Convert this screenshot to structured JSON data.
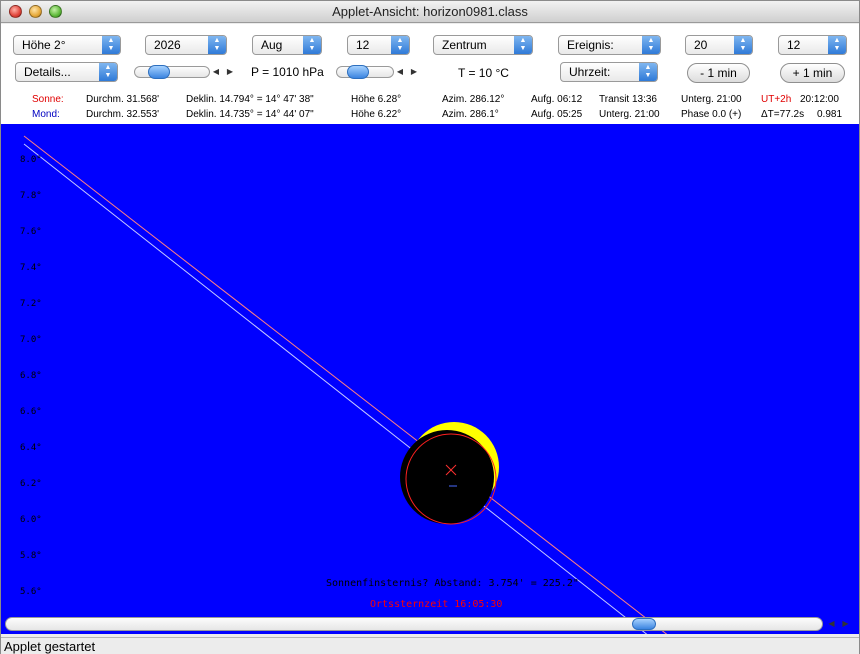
{
  "window": {
    "title": "Applet-Ansicht: horizon0981.class"
  },
  "toolbar": {
    "hoehe_select": "Höhe 2°",
    "year_select": "2026",
    "month_select": "Aug",
    "day_select": "12",
    "view_select": "Zentrum",
    "event_select": "Ereignis:",
    "hour_select": "20",
    "minute_select": "12",
    "details_select": "Details...",
    "pressure_label": "P = 1010 hPa",
    "temperature_label": "T = 10 °C",
    "time_mode_select": "Uhrzeit:",
    "minus_button": "- 1 min",
    "plus_button": "+ 1 min",
    "pressure_slider_value": 0.25,
    "temperature_slider_value": 0.3
  },
  "sun_info": {
    "label": "Sonne:",
    "diameter": "Durchm. 31.568'",
    "declination": "Deklin. 14.794° = 14° 47' 38\"",
    "altitude": "Höhe 6.28°",
    "azimuth": "Azim. 286.12°",
    "rise": "Aufg. 06:12",
    "transit": "Transit 13:36",
    "set": "Unterg. 21:00",
    "timezone": "UT+2h",
    "time": "20:12:00"
  },
  "moon_info": {
    "label": "Mond:",
    "diameter": "Durchm. 32.553'",
    "declination": "Deklin. 14.735° = 14° 44' 07\"",
    "altitude": "Höhe 6.22°",
    "azimuth": "Azim. 286.1°",
    "rise": "Aufg. 05:25",
    "set": "Unterg. 21:00",
    "phase": "Phase 0.0 (+)",
    "delta_t": "ΔT=77.2s",
    "magnitude": "0.981"
  },
  "canvas": {
    "y_labels": [
      "8.0°",
      "7.8°",
      "7.6°",
      "7.4°",
      "7.2°",
      "7.0°",
      "6.8°",
      "6.6°",
      "6.4°",
      "6.2°",
      "6.0°",
      "5.8°",
      "5.6°"
    ],
    "eclipse_message": "Sonnenfinsternis? Abstand: 3.754' = 225.2\"",
    "sidereal_time": "Ortssternzeit 16:05:30",
    "colors": {
      "sky": "#0000ff",
      "sun": "#ffff00",
      "moon": "#000000",
      "red": "#ff0000"
    }
  },
  "scrollbar": {
    "position": 0.79
  },
  "status": {
    "text": "Applet gestartet"
  }
}
